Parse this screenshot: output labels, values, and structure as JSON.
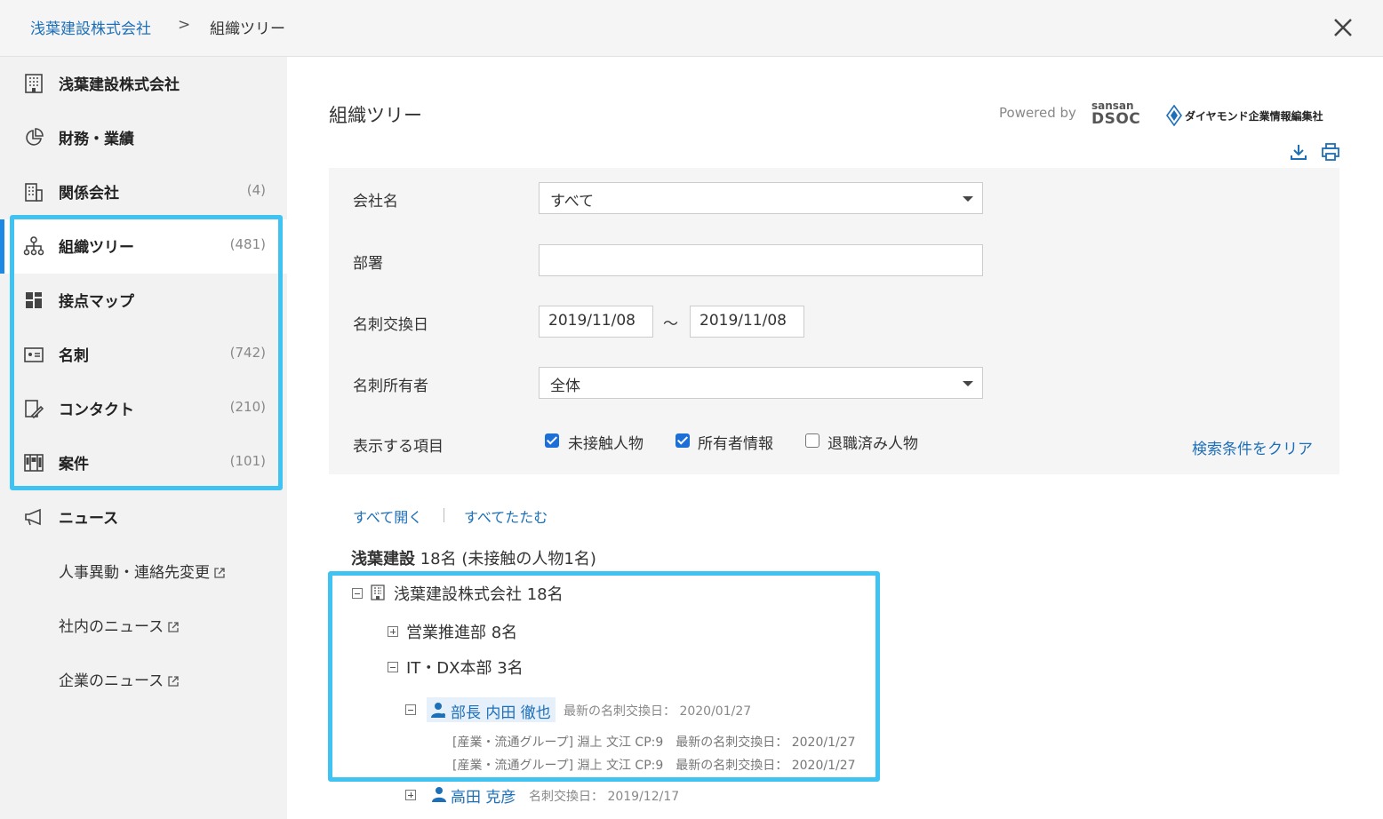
{
  "breadcrumb": {
    "company": "浅葉建設株式会社",
    "separator": ">",
    "current": "組織ツリー"
  },
  "sidebar": {
    "items": [
      {
        "label": "浅葉建設株式会社",
        "count": ""
      },
      {
        "label": "財務・業績",
        "count": ""
      },
      {
        "label": "関係会社",
        "count": "(4)"
      },
      {
        "label": "組織ツリー",
        "count": "(481)"
      },
      {
        "label": "接点マップ",
        "count": ""
      },
      {
        "label": "名刺",
        "count": "(742)"
      },
      {
        "label": "コンタクト",
        "count": "(210)"
      },
      {
        "label": "案件",
        "count": "(101)"
      },
      {
        "label": "ニュース",
        "count": ""
      }
    ],
    "news_subitems": [
      "人事異動・連絡先変更",
      "社内のニュース",
      "企業のニュース"
    ]
  },
  "main": {
    "title": "組織ツリー",
    "powered_by": "Powered by",
    "sansan_top": "sansan",
    "sansan_bottom": "DSOC",
    "diamond_text": "ダイヤモンド企業情報編集社"
  },
  "filters": {
    "company_label": "会社名",
    "company_value": "すべて",
    "dept_label": "部署",
    "dept_value": "",
    "date_label": "名刺交換日",
    "date_from": "2019/11/08",
    "date_sep": "～",
    "date_to": "2019/11/08",
    "owner_label": "名刺所有者",
    "owner_value": "全体",
    "display_label": "表示する項目",
    "checkboxes": [
      {
        "label": "未接触人物",
        "checked": true
      },
      {
        "label": "所有者情報",
        "checked": true
      },
      {
        "label": "退職済み人物",
        "checked": false
      }
    ],
    "clear_label": "検索条件をクリア"
  },
  "tree": {
    "expand_all": "すべて開く",
    "collapse_all": "すべてたたむ",
    "summary_name": "浅葉建設",
    "summary_detail": "18名 (未接触の人物1名)",
    "root": "浅葉建設株式会社 18名",
    "dept1": "営業推進部 8名",
    "dept2": "IT・DX本部 3名",
    "person1_name": "部長 内田 徹也",
    "person1_meta": "最新の名刺交換日： 2020/01/27",
    "card_lines": [
      "[産業・流通グループ] 淵上 文江 CP:9　最新の名刺交換日： 2020/1/27",
      "[産業・流通グループ] 淵上 文江 CP:9　最新の名刺交換日： 2020/1/27"
    ],
    "person2_name": "高田 克彦",
    "person2_meta": "名刺交換日： 2019/12/17"
  }
}
